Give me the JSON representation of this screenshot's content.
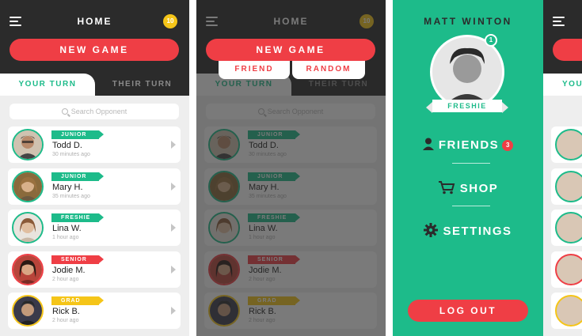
{
  "app": {
    "title": "HOME",
    "coins": "10",
    "new_game_label": "NEW GAME",
    "tabs": {
      "your_turn": "YOUR TURN",
      "their_turn": "THEIR TURN"
    },
    "search": {
      "placeholder": "Search Opponent"
    }
  },
  "opponents": [
    {
      "name": "Todd D.",
      "rank": "JUNIOR",
      "rank_color": "#1dbb8a",
      "time": "30 minutes ago",
      "ring": "#1dbb8a"
    },
    {
      "name": "Mary H.",
      "rank": "JUNIOR",
      "rank_color": "#1dbb8a",
      "time": "35 minutes ago",
      "ring": "#1dbb8a"
    },
    {
      "name": "Lina W.",
      "rank": "FRESHIE",
      "rank_color": "#1dbb8a",
      "time": "1 hour ago",
      "ring": "#1dbb8a"
    },
    {
      "name": "Jodie M.",
      "rank": "SENIOR",
      "rank_color": "#ef3e45",
      "time": "2 hour ago",
      "ring": "#ef3e45"
    },
    {
      "name": "Rick B.",
      "rank": "GRAD",
      "rank_color": "#f5c518",
      "time": "2 hour ago",
      "ring": "#f5c518"
    }
  ],
  "new_game_menu": {
    "friend": "FRIEND",
    "random": "RANDOM"
  },
  "side_menu": {
    "user_name": "MATT WINTON",
    "level": "1",
    "rank": "FRESHIE",
    "friends_label": "FRIENDS",
    "friends_count": "3",
    "shop_label": "SHOP",
    "settings_label": "SETTINGS",
    "logout_label": "LOG OUT"
  },
  "colors": {
    "accent_green": "#1dbb8a",
    "accent_red": "#ef3e45",
    "gold": "#f5c518",
    "header_dark": "#2b2b2b"
  },
  "icons": [
    "menu-icon",
    "coin-icon",
    "search-icon",
    "chevron-right-icon",
    "person-icon",
    "cart-icon",
    "gear-icon"
  ]
}
